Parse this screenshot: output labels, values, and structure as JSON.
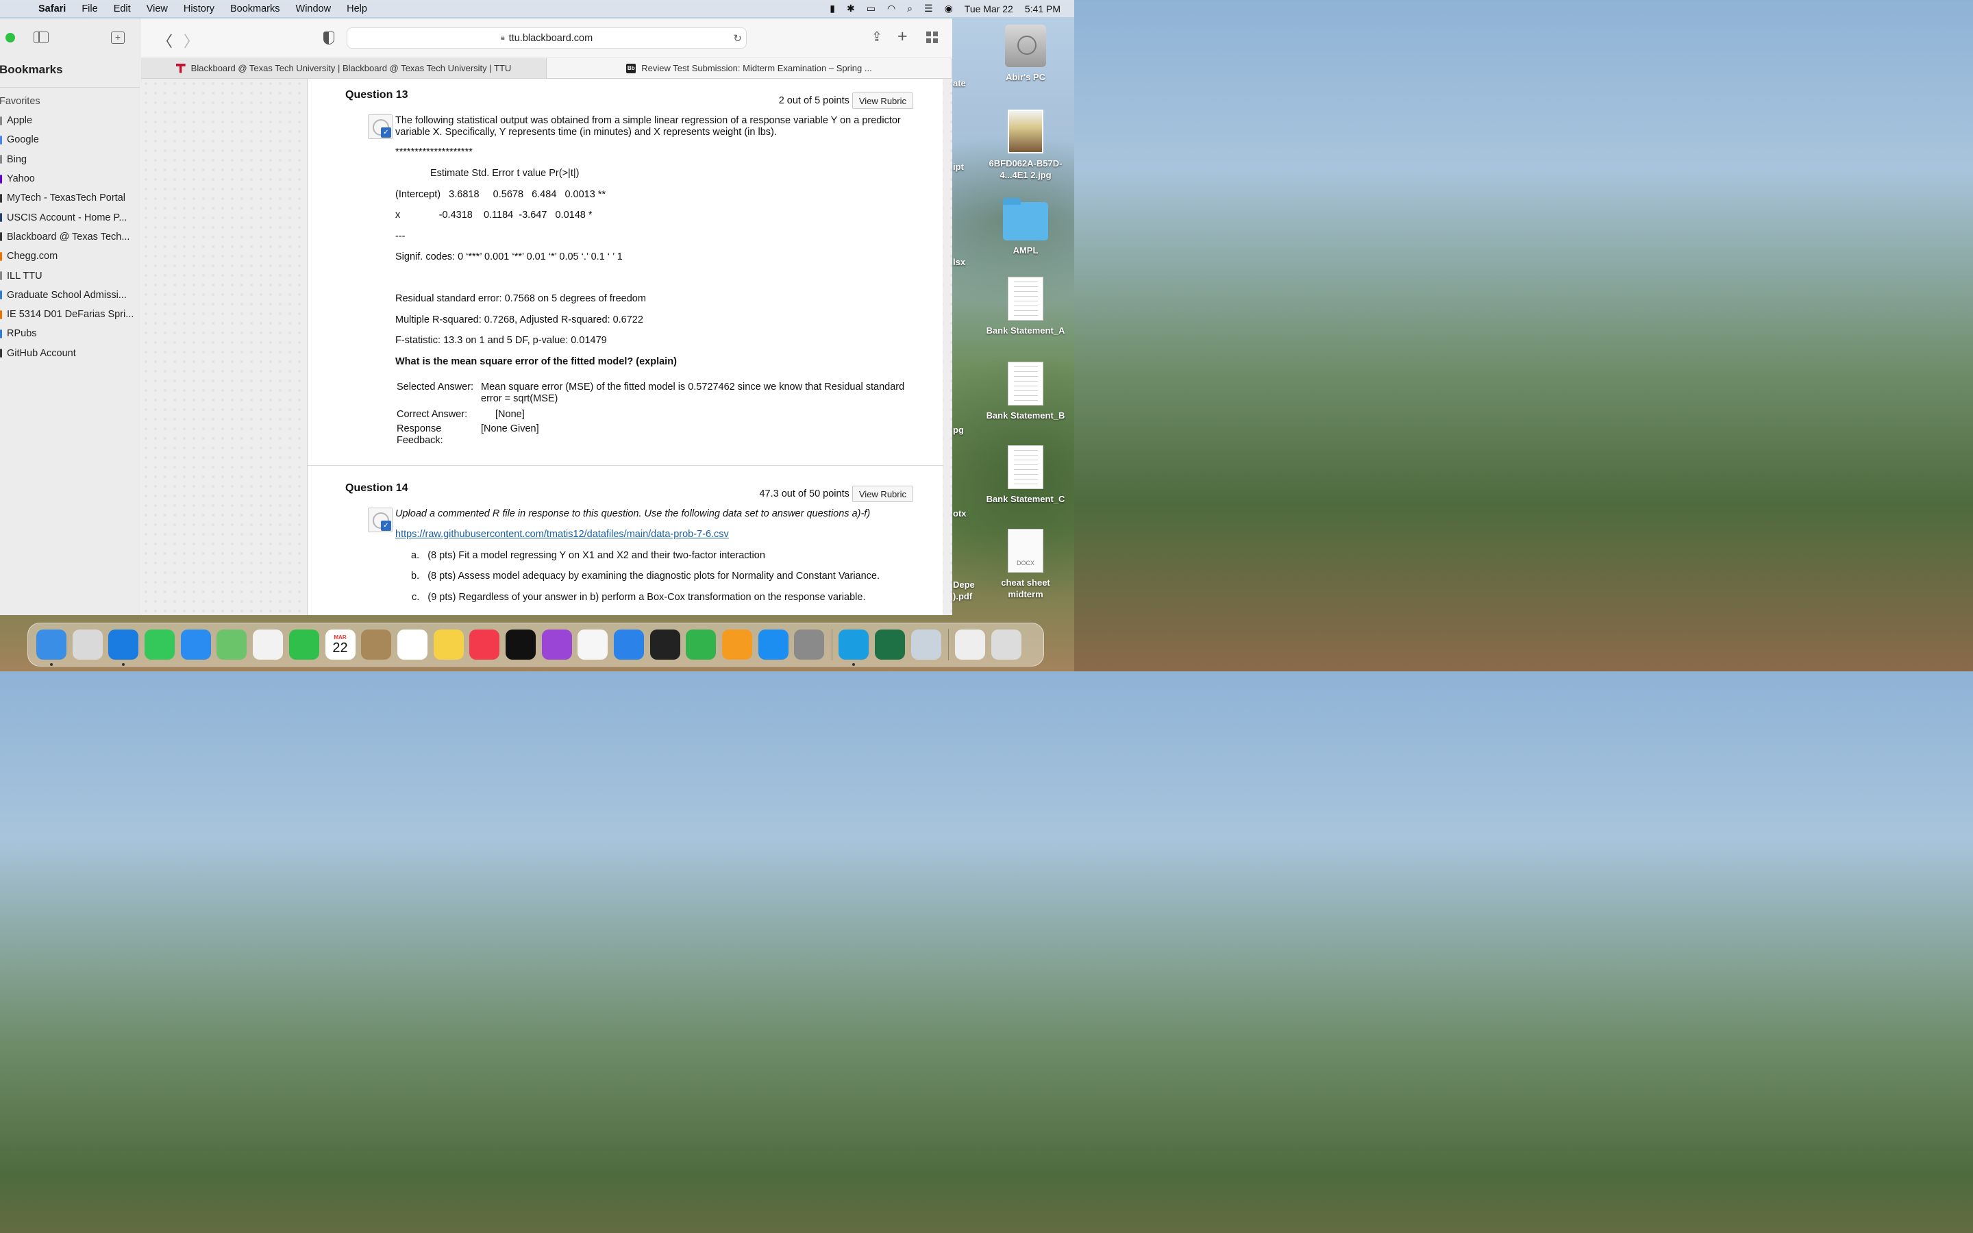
{
  "menubar": {
    "app": "Safari",
    "items": [
      "File",
      "Edit",
      "View",
      "History",
      "Bookmarks",
      "Window",
      "Help"
    ],
    "date": "Tue Mar 22",
    "time": "5:41 PM"
  },
  "sidebar": {
    "title": "Bookmarks",
    "favorites_header": "Favorites",
    "items": [
      {
        "label": "Apple",
        "color": "#888888"
      },
      {
        "label": "Google",
        "color": "#4285f4"
      },
      {
        "label": "Bing",
        "color": "#888888"
      },
      {
        "label": "Yahoo",
        "color": "#6001d2"
      },
      {
        "label": "MyTech - TexasTech Portal",
        "color": "#333333"
      },
      {
        "label": "USCIS Account - Home P...",
        "color": "#1f3f6e"
      },
      {
        "label": "Blackboard @ Texas Tech...",
        "color": "#333333"
      },
      {
        "label": "Chegg.com",
        "color": "#eb7100"
      },
      {
        "label": "ILL TTU",
        "color": "#888888"
      },
      {
        "label": "Graduate School Admissi...",
        "color": "#2d7dd2"
      },
      {
        "label": "IE 5314 D01 DeFarias Spri...",
        "color": "#eb7100"
      },
      {
        "label": "RPubs",
        "color": "#2d7dd2"
      },
      {
        "label": "GitHub Account",
        "color": "#333333"
      }
    ]
  },
  "toolbar": {
    "url": "ttu.blackboard.com"
  },
  "tabs": [
    {
      "label": "Blackboard @ Texas Tech University | Blackboard @ Texas Tech University | TTU"
    },
    {
      "label": "Review Test Submission: Midterm Examination – Spring ..."
    }
  ],
  "q13": {
    "title": "Question 13",
    "points": "2 out of 5 points",
    "rubric": "View Rubric",
    "intro": "The following statistical output was obtained from a simple linear regression of a response variable Y on a predictor variable X.  Specifically, Y represents time (in minutes) and X represents weight (in lbs).",
    "stars": "********************",
    "header_row": "Estimate Std. Error t value Pr(>|t|)",
    "intercept_row": "(Intercept)   3.6818     0.5678   6.484   0.0013 **",
    "x_row": "x              -0.4318    0.1184  -3.647   0.0148 *",
    "dashes": "---",
    "signif": "Signif. codes:  0 ‘***’ 0.001 ‘**’ 0.01 ‘*’ 0.05 ‘.’ 0.1 ‘ ’ 1",
    "rse": "Residual standard error: 0.7568 on 5 degrees of freedom",
    "r2": "Multiple R-squared:  0.7268, Adjusted R-squared:  0.6722",
    "fstat": "F-statistic:  13.3 on 1 and 5 DF,  p-value: 0.01479",
    "prompt": "What is the mean square error of the fitted model? (explain)",
    "selected_label": "Selected Answer:",
    "selected_value": "Mean square error (MSE) of the fitted model is 0.5727462 since we know that Residual standard error = sqrt(MSE)",
    "correct_label": "Correct Answer:",
    "correct_value": "[None]",
    "feedback_label": "Response Feedback:",
    "feedback_value": "[None Given]"
  },
  "q14": {
    "title": "Question 14",
    "points": "47.3 out of 50 points",
    "rubric": "View Rubric",
    "intro": "Upload a commented R file in response to this question. Use the following data set to answer questions a)-f)",
    "link": "https://raw.githubusercontent.com/tmatis12/datafiles/main/data-prob-7-6.csv",
    "items": [
      {
        "marker": "a.",
        "text": "(8 pts) Fit a model regressing Y on X1 and X2 and their two-factor interaction"
      },
      {
        "marker": "b.",
        "text": "(8 pts) Assess model adequacy by examining the diagnostic plots for Normality and Constant Variance."
      },
      {
        "marker": "c.",
        "text": "(9 pts) Regardless of your answer in b) perform a Box-Cox transformation on the response variable."
      }
    ]
  },
  "desktop": {
    "icons": [
      {
        "label": "Abir's PC"
      },
      {
        "label": "6BFD062A-B57D-4...4E1 2.jpg"
      },
      {
        "label": "AMPL"
      },
      {
        "label": "Bank Statement_A"
      },
      {
        "label": "Bank Statement_B"
      },
      {
        "label": "Bank Statement_C"
      },
      {
        "label": "cheat sheet midterm",
        "badge": "DOCX"
      }
    ],
    "edge_fragments": [
      "ate",
      "ipt",
      "lsx",
      "pg",
      "otx",
      "Depe",
      ").pdf"
    ]
  },
  "dock": {
    "calendar_month": "MAR",
    "calendar_day": "22",
    "apps": [
      {
        "name": "Finder",
        "color": "#3a8ee6"
      },
      {
        "name": "Launchpad",
        "color": "#d9d9d9"
      },
      {
        "name": "Safari",
        "color": "#1a7ce0"
      },
      {
        "name": "Messages",
        "color": "#34c759"
      },
      {
        "name": "Mail",
        "color": "#2a8cf0"
      },
      {
        "name": "Maps",
        "color": "#6cc46a"
      },
      {
        "name": "Photos",
        "color": "#f2f2f2"
      },
      {
        "name": "FaceTime",
        "color": "#2fbf4a"
      },
      {
        "name": "Calendar",
        "color": "#ffffff"
      },
      {
        "name": "Contacts",
        "color": "#a88758"
      },
      {
        "name": "Reminders",
        "color": "#ffffff"
      },
      {
        "name": "Notes",
        "color": "#f7d145"
      },
      {
        "name": "Music",
        "color": "#f23a4c"
      },
      {
        "name": "TV",
        "color": "#111111"
      },
      {
        "name": "Podcasts",
        "color": "#9b45d6"
      },
      {
        "name": "News",
        "color": "#f6f6f6"
      },
      {
        "name": "Keynote",
        "color": "#2b82e8"
      },
      {
        "name": "Stocks",
        "color": "#222222"
      },
      {
        "name": "Numbers",
        "color": "#33b34b"
      },
      {
        "name": "Pages",
        "color": "#f59b1f"
      },
      {
        "name": "App Store",
        "color": "#1c8ef2"
      },
      {
        "name": "System Preferences",
        "color": "#8a8a8a"
      },
      {
        "name": "Skype",
        "color": "#1a9de1"
      },
      {
        "name": "Excel",
        "color": "#1e7145"
      },
      {
        "name": "Preview",
        "color": "#c9d3dd"
      },
      {
        "name": "Downloads",
        "color": "#eeeeee"
      },
      {
        "name": "Trash",
        "color": "#dcdcdc"
      }
    ]
  }
}
